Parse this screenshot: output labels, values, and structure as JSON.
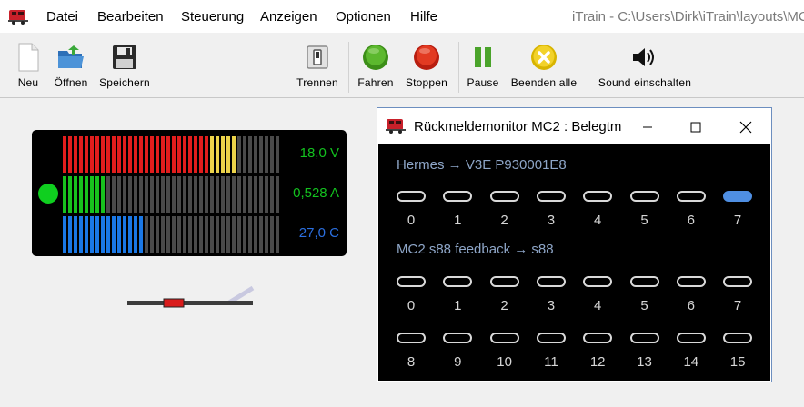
{
  "menubar": {
    "items": [
      "Datei",
      "Bearbeiten",
      "Steuerung",
      "Anzeigen",
      "Optionen",
      "Hilfe"
    ],
    "window_title": "iTrain - C:\\Users\\Dirk\\iTrain\\layouts\\MC"
  },
  "toolbar": {
    "new_label": "Neu",
    "open_label": "Öffnen",
    "save_label": "Speichern",
    "disconnect_label": "Trennen",
    "drive_label": "Fahren",
    "stop_label": "Stoppen",
    "pause_label": "Pause",
    "end_all_label": "Beenden alle",
    "sound_label": "Sound einschalten"
  },
  "booster": {
    "voltage": "18,0 V",
    "current": "0,528 A",
    "temperature": "27,0 C",
    "voltage_level": 0.81,
    "current_level": 0.19,
    "temperature_level": 0.38,
    "status_color": "#0fcf1f"
  },
  "dialog": {
    "title": "Rückmeldemonitor MC2 : Belegtm",
    "group1": {
      "title": "Hermes → V3E P930001E8",
      "numbers": [
        "0",
        "1",
        "2",
        "3",
        "4",
        "5",
        "6",
        "7"
      ],
      "active": [
        false,
        false,
        false,
        false,
        false,
        false,
        false,
        true
      ]
    },
    "group2": {
      "title": "MC2 s88 feedback → s88",
      "numbers_row1": [
        "0",
        "1",
        "2",
        "3",
        "4",
        "5",
        "6",
        "7"
      ],
      "numbers_row2": [
        "8",
        "9",
        "10",
        "11",
        "12",
        "13",
        "14",
        "15"
      ]
    }
  },
  "colors": {
    "active_feedback": "#4f8fe3",
    "voltage_text": "#13c21f",
    "current_text": "#13c21f",
    "temperature_text": "#2b6fe0"
  }
}
